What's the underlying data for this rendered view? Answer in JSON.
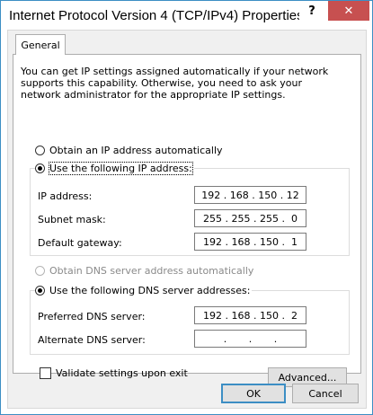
{
  "window": {
    "title": "Internet Protocol Version 4 (TCP/IPv4) Properties",
    "help_glyph": "?",
    "close_glyph": "✕"
  },
  "tabs": [
    {
      "label": "General"
    }
  ],
  "general": {
    "description": "You can get IP settings assigned automatically if your network supports this capability. Otherwise, you need to ask your network administrator for the appropriate IP settings.",
    "ip": {
      "auto_label": "Obtain an IP address automatically",
      "manual_label": "Use the following IP address:",
      "selected": "manual",
      "fields": [
        {
          "label": "IP address:",
          "value": "192 . 168 . 150 . 12"
        },
        {
          "label": "Subnet mask:",
          "value": "255 . 255 . 255 .  0"
        },
        {
          "label": "Default gateway:",
          "value": "192 . 168 . 150 .  1"
        }
      ]
    },
    "dns": {
      "auto_label": "Obtain DNS server address automatically",
      "manual_label": "Use the following DNS server addresses:",
      "selected": "manual",
      "fields": [
        {
          "label": "Preferred DNS server:",
          "value": "192 . 168 . 150 .  2"
        },
        {
          "label": "Alternate DNS server:",
          "value": ".       .       ."
        }
      ]
    },
    "validate_label": "Validate settings upon exit",
    "validate_checked": false,
    "advanced_label": "Advanced..."
  },
  "footer": {
    "ok_label": "OK",
    "cancel_label": "Cancel"
  },
  "colors": {
    "accent": "#3c8ec4",
    "close_button": "#c75050",
    "dialog_background": "#f0f0f0",
    "disabled_text": "#8a8a8a"
  }
}
